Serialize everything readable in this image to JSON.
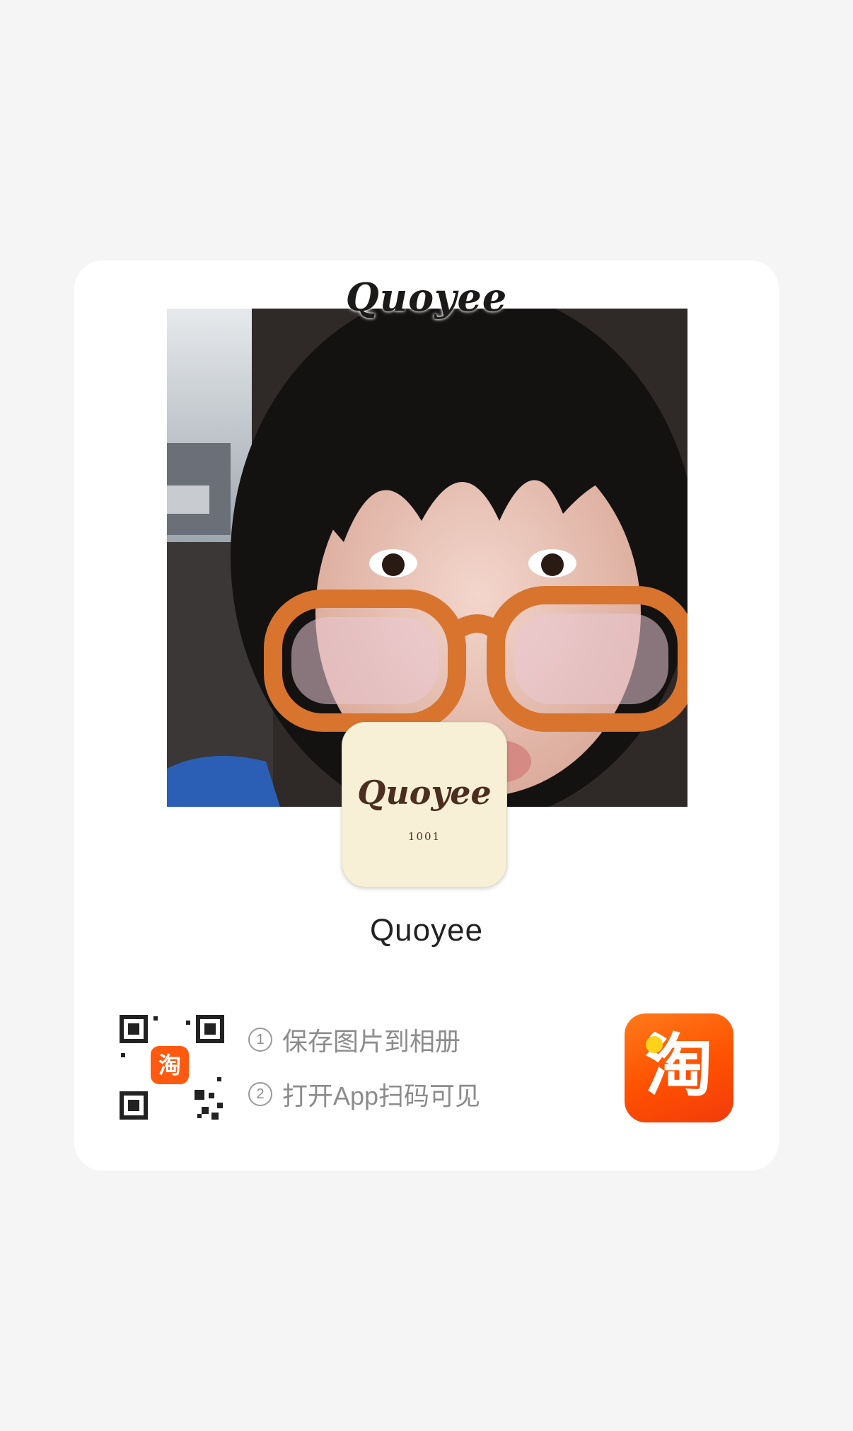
{
  "banner": {
    "logo_text": "Quoyee"
  },
  "avatar": {
    "logo_text": "Quoyee",
    "sub_text": "1001"
  },
  "shop": {
    "name": "Quoyee"
  },
  "qr": {
    "badge_char": "淘"
  },
  "steps": [
    {
      "num": "1",
      "text": "保存图片到相册"
    },
    {
      "num": "2",
      "text": "打开App扫码可见"
    }
  ],
  "app_icon": {
    "char": "淘",
    "name": "taobao-app-icon"
  },
  "colors": {
    "brand": "#ff5000",
    "background": "#f5f5f5",
    "card": "#ffffff"
  }
}
